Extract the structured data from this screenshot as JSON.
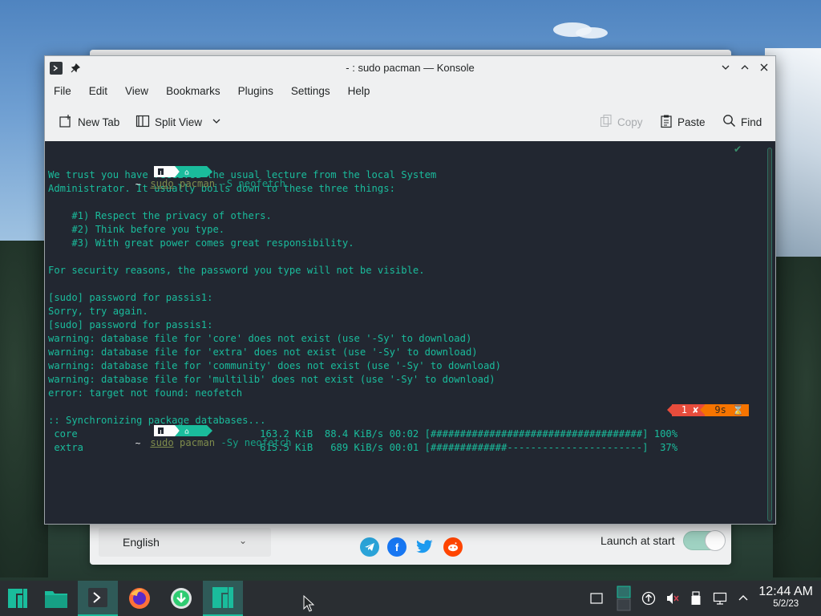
{
  "window": {
    "title": "- : sudo pacman — Konsole"
  },
  "menu": [
    "File",
    "Edit",
    "View",
    "Bookmarks",
    "Plugins",
    "Settings",
    "Help"
  ],
  "toolbar": {
    "new_tab": "New Tab",
    "split_view": "Split View",
    "copy": "Copy",
    "paste": "Paste",
    "find": "Find"
  },
  "terminal": {
    "prompt1": {
      "dir": "~",
      "cmd_kw": "sudo",
      "cmd_kw2": "pacman",
      "cmd_rest": " -S neofetch"
    },
    "lines_block1": [
      "",
      "We trust you have received the usual lecture from the local System",
      "Administrator. It usually boils down to these three things:",
      "",
      "    #1) Respect the privacy of others.",
      "    #2) Think before you type.",
      "    #3) With great power comes great responsibility.",
      "",
      "For security reasons, the password you type will not be visible.",
      "",
      "[sudo] password for passis1:",
      "Sorry, try again.",
      "[sudo] password for passis1:",
      "warning: database file for 'core' does not exist (use '-Sy' to download)",
      "warning: database file for 'extra' does not exist (use '-Sy' to download)",
      "warning: database file for 'community' does not exist (use '-Sy' to download)",
      "warning: database file for 'multilib' does not exist (use '-Sy' to download)",
      "error: target not found: neofetch"
    ],
    "prompt2": {
      "dir": "~",
      "cmd_kw": "sudo",
      "cmd_kw2": "pacman",
      "cmd_rest": " -Sy neofetch"
    },
    "status_badge": {
      "exit": "1 ✘",
      "duration": "9s ⌛"
    },
    "lines_block2": [
      ":: Synchronizing package databases...",
      " core                               163.2 KiB  88.4 KiB/s 00:02 [####################################] 100%",
      " extra                              615.5 KiB   689 KiB/s 00:01 [#############-----------------------]  37%"
    ]
  },
  "welcome_app": {
    "language": "English",
    "launch_at_start": "Launch at start",
    "launch_enabled": true
  },
  "clock": {
    "time": "12:44 AM",
    "date": "5/2/23"
  },
  "colors": {
    "terminal_bg": "#222731",
    "terminal_fg": "#1abc9c",
    "accent": "#1abc9c",
    "error_badge": "#e74c3c",
    "duration_badge": "#f67400"
  }
}
